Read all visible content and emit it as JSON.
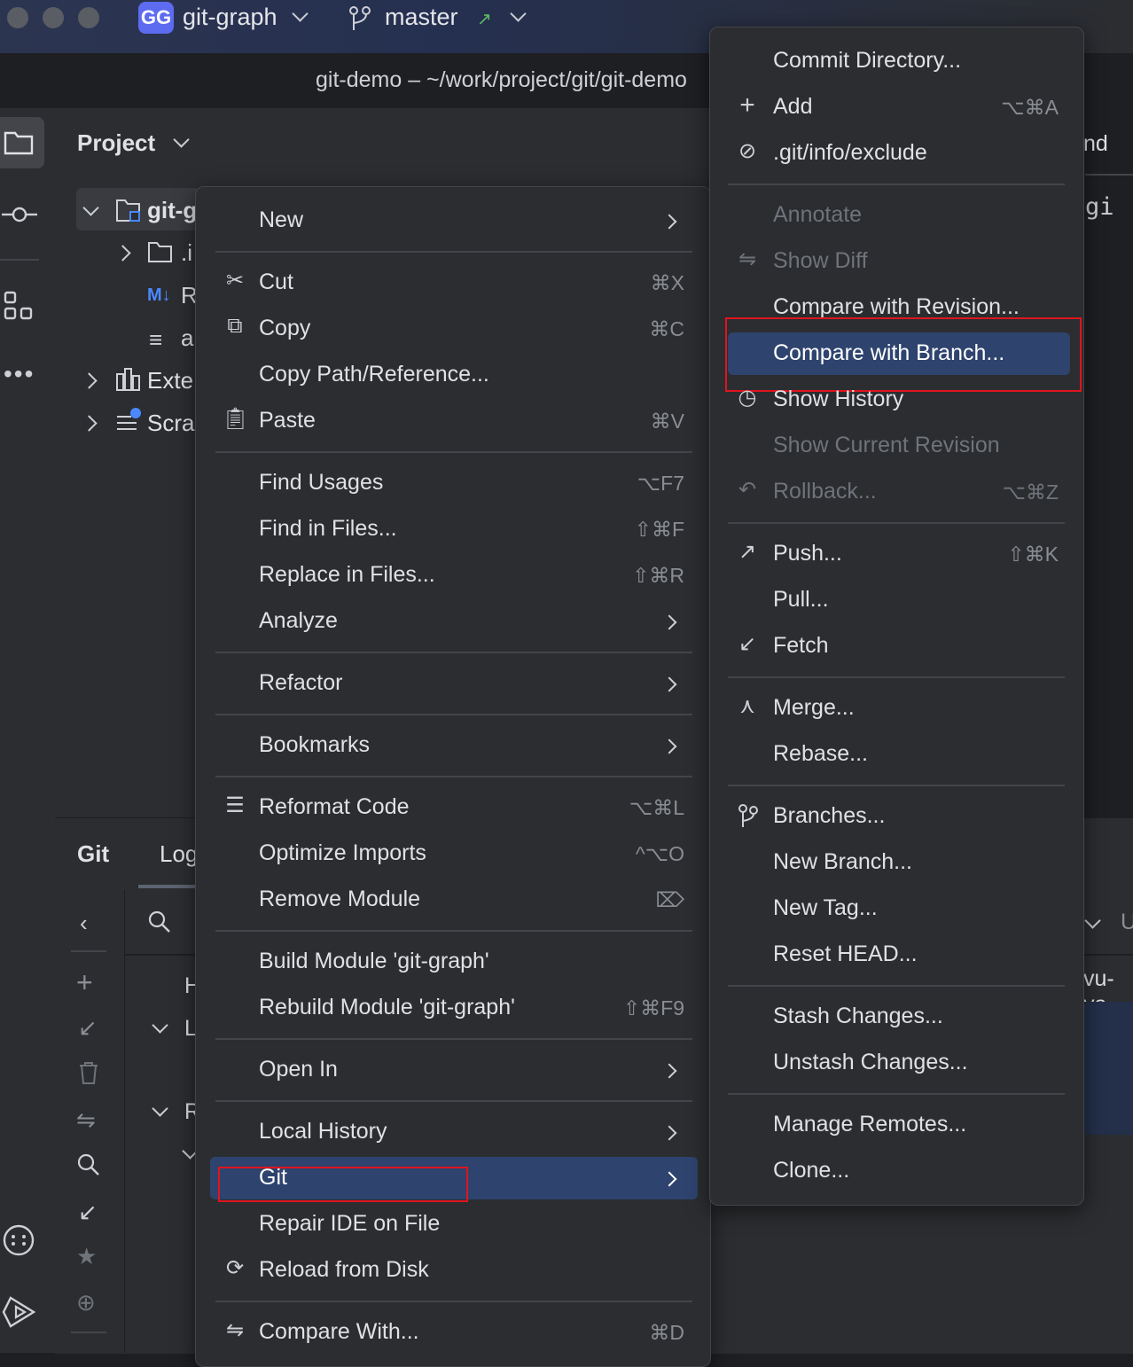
{
  "titlebar": {
    "project_badge": "GG",
    "project_name": "git-graph",
    "branch": "master",
    "branch_status_icon": "arrow-up-right-icon"
  },
  "path": "git-demo – ~/work/project/git/git-demo",
  "project_panel": {
    "title": "Project",
    "tree": [
      "git-g",
      ".i",
      "R",
      "a",
      "Exte",
      "Scra"
    ],
    "md_badge": "M↓"
  },
  "git_panel": {
    "tab_git": "Git",
    "tab_log": "Log",
    "rows": [
      "H",
      "L",
      "R"
    ]
  },
  "editor_remnants": {
    "tab_end": "nd",
    "file_prefix": "gi",
    "branch_prefix": "U",
    "author": "vu-ya"
  },
  "context_menu": {
    "items": [
      {
        "label": "New",
        "shortcut": "",
        "submenu": true,
        "icon": ""
      },
      {
        "label": "Cut",
        "shortcut": "⌘X",
        "icon": "scissors-icon"
      },
      {
        "label": "Copy",
        "shortcut": "⌘C",
        "icon": "copy-icon"
      },
      {
        "label": "Copy Path/Reference...",
        "shortcut": ""
      },
      {
        "label": "Paste",
        "shortcut": "⌘V",
        "icon": "clipboard-icon"
      },
      {
        "label": "Find Usages",
        "shortcut": "⌥F7"
      },
      {
        "label": "Find in Files...",
        "shortcut": "⇧⌘F"
      },
      {
        "label": "Replace in Files...",
        "shortcut": "⇧⌘R"
      },
      {
        "label": "Analyze",
        "submenu": true
      },
      {
        "label": "Refactor",
        "submenu": true
      },
      {
        "label": "Bookmarks",
        "submenu": true
      },
      {
        "label": "Reformat Code",
        "shortcut": "⌥⌘L",
        "icon": "reformat-icon"
      },
      {
        "label": "Optimize Imports",
        "shortcut": "^⌥O"
      },
      {
        "label": "Remove Module",
        "shortcut": "⌦"
      },
      {
        "label": "Build Module 'git-graph'",
        "shortcut": ""
      },
      {
        "label": "Rebuild Module 'git-graph'",
        "shortcut": "⇧⌘F9"
      },
      {
        "label": "Open In",
        "submenu": true
      },
      {
        "label": "Local History",
        "submenu": true
      },
      {
        "label": "Git",
        "submenu": true,
        "highlighted": true
      },
      {
        "label": "Repair IDE on File",
        "shortcut": ""
      },
      {
        "label": "Reload from Disk",
        "shortcut": "",
        "icon": "reload-icon"
      },
      {
        "label": "Compare With...",
        "shortcut": "⌘D",
        "icon": "compare-icon"
      }
    ]
  },
  "git_menu": {
    "items": [
      {
        "label": "Commit Directory...",
        "shortcut": ""
      },
      {
        "label": "Add",
        "shortcut": "⌥⌘A",
        "icon": "plus-icon"
      },
      {
        "label": ".git/info/exclude",
        "shortcut": "",
        "icon": "ignore-icon"
      },
      {
        "label": "Annotate",
        "disabled": true
      },
      {
        "label": "Show Diff",
        "disabled": true,
        "icon": "diff-icon"
      },
      {
        "label": "Compare with Revision..."
      },
      {
        "label": "Compare with Branch...",
        "highlighted": true
      },
      {
        "label": "Show History",
        "icon": "clock-icon"
      },
      {
        "label": "Show Current Revision",
        "disabled": true
      },
      {
        "label": "Rollback...",
        "shortcut": "⌥⌘Z",
        "disabled": true,
        "icon": "rollback-icon"
      },
      {
        "label": "Push...",
        "shortcut": "⇧⌘K",
        "icon": "push-icon"
      },
      {
        "label": "Pull..."
      },
      {
        "label": "Fetch",
        "icon": "fetch-icon"
      },
      {
        "label": "Merge...",
        "icon": "merge-icon"
      },
      {
        "label": "Rebase..."
      },
      {
        "label": "Branches...",
        "icon": "branch-icon"
      },
      {
        "label": "New Branch..."
      },
      {
        "label": "New Tag..."
      },
      {
        "label": "Reset HEAD..."
      },
      {
        "label": "Stash Changes..."
      },
      {
        "label": "Unstash Changes..."
      },
      {
        "label": "Manage Remotes..."
      },
      {
        "label": "Clone..."
      }
    ]
  },
  "colors": {
    "highlight": "#2e436e",
    "annotation_red": "#e0141e",
    "accent_green": "#5fb865"
  }
}
